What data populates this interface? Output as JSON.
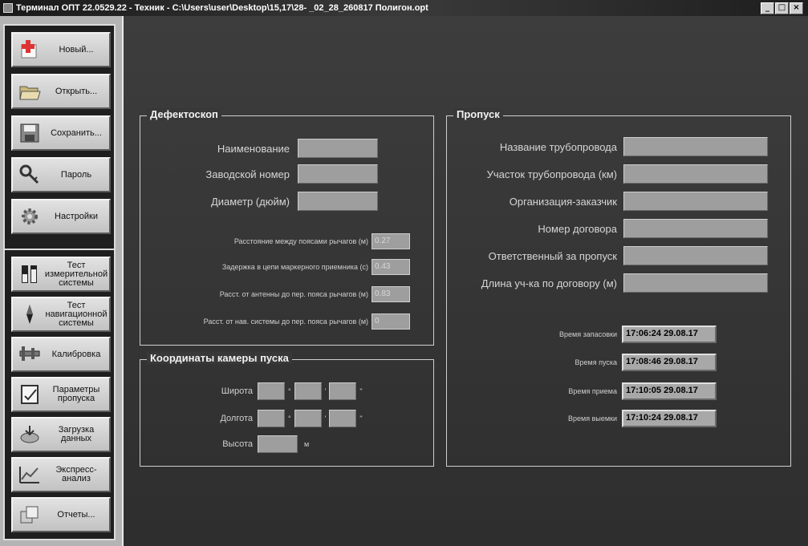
{
  "window": {
    "title": "Терминал ОПТ 22.0529.22 - Техник - C:\\Users\\user\\Desktop\\15,17\\28-      _02_28_260817 Полигон.opt",
    "min": "_",
    "max": "□",
    "close": "×"
  },
  "sidebar": {
    "file_buttons": [
      {
        "label": "Новый...",
        "icon": "new-plus-icon"
      },
      {
        "label": "Открыть...",
        "icon": "open-folder-icon"
      },
      {
        "label": "Сохранить...",
        "icon": "save-icon"
      },
      {
        "label": "Пароль",
        "icon": "keys-icon"
      },
      {
        "label": "Настройки",
        "icon": "gear-icon"
      }
    ],
    "tool_buttons": [
      {
        "label": "Тест\nизмерительной\nсистемы",
        "icon": "measure-test-icon"
      },
      {
        "label": "Тест\nнавигационной\nсистемы",
        "icon": "compass-icon"
      },
      {
        "label": "Калибровка",
        "icon": "caliper-icon"
      },
      {
        "label": "Параметры\nпропуска",
        "icon": "params-icon"
      },
      {
        "label": "Загрузка\nданных",
        "icon": "load-data-icon"
      },
      {
        "label": "Экспресс-\nанализ",
        "icon": "chart-icon"
      },
      {
        "label": "Отчеты...",
        "icon": "reports-icon"
      }
    ]
  },
  "defectoscope": {
    "title": "Дефектоскоп",
    "name_label": "Наименование",
    "serial_label": "Заводской номер",
    "diameter_label": "Диаметр (дюйм)",
    "params": [
      {
        "label": "Расстояние между поясами рычагов (м)",
        "value": "0.27"
      },
      {
        "label": "Задержка в цепи маркерного приемника (с)",
        "value": "0.43"
      },
      {
        "label": "Расст. от антенны до пер. пояса рычагов (м)",
        "value": "0.83"
      },
      {
        "label": "Расст. от нав. системы до пер. пояса рычагов (м)",
        "value": "0"
      }
    ]
  },
  "launch": {
    "title": "Координаты камеры пуска",
    "lat_label": "Широта",
    "lon_label": "Долгота",
    "alt_label": "Высота",
    "deg": "°",
    "min": "'",
    "sec": "\"",
    "alt_unit": "м"
  },
  "pass": {
    "title": "Пропуск",
    "fields": [
      "Название трубопровода",
      "Участок трубопровода (км)",
      "Организация-заказчик",
      "Номер договора",
      "Ответственный за пропуск",
      "Длина уч-ка по договору (м)"
    ],
    "times": [
      {
        "label": "Время запасовки",
        "value": "17:06:24 29.08.17"
      },
      {
        "label": "Время пуска",
        "value": "17:08:46 29.08.17"
      },
      {
        "label": "Время приема",
        "value": "17:10:05 29.08.17"
      },
      {
        "label": "Время выемки",
        "value": "17:10:24 29.08.17"
      }
    ]
  }
}
